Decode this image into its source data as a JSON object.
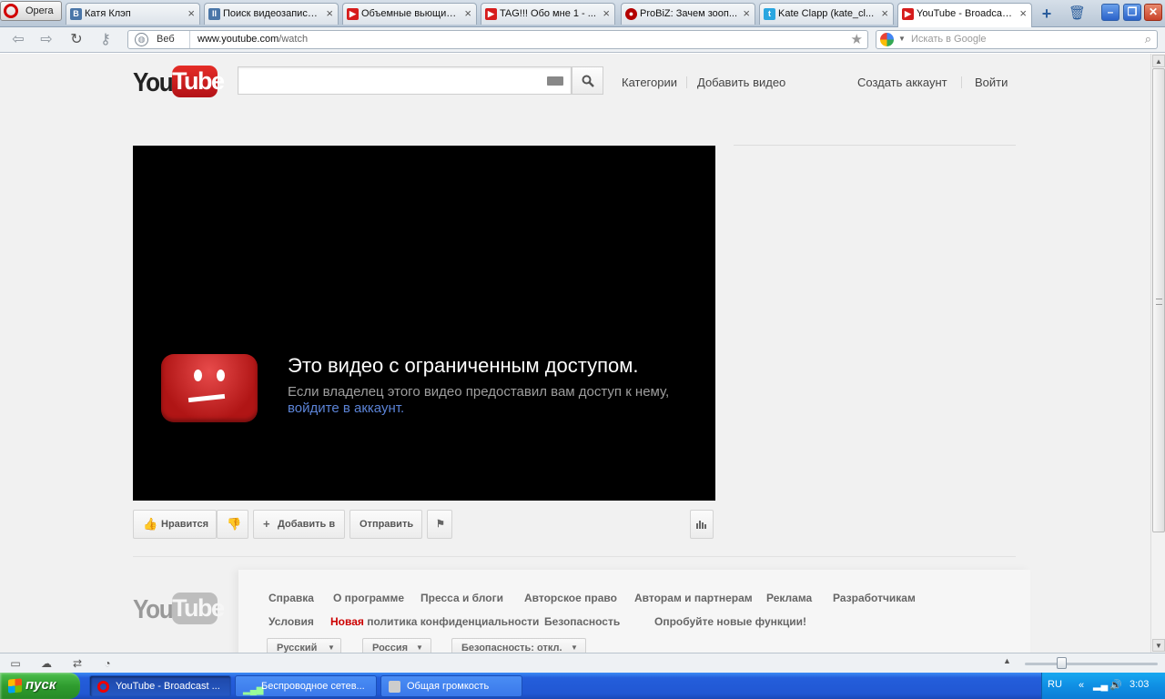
{
  "browser": {
    "menu_label": "Opera",
    "tabs": [
      {
        "title": "Катя Клэп",
        "icon": "vk-icon",
        "favicon_text": "B"
      },
      {
        "title": "Поиск видеозаписе...",
        "icon": "pause-icon",
        "favicon_text": "II"
      },
      {
        "title": "Объемные вьющие...",
        "icon": "youtube-icon",
        "favicon_text": "▶"
      },
      {
        "title": "TAG!!! Обо мне 1 - ...",
        "icon": "youtube-icon",
        "favicon_text": "▶"
      },
      {
        "title": "ProBiZ: Зачем зооп...",
        "icon": "probiz-icon",
        "favicon_text": "●"
      },
      {
        "title": "Kate Clapp (kate_cl...",
        "icon": "twitter-icon",
        "favicon_text": "t"
      },
      {
        "title": "YouTube - Broadcas...",
        "icon": "youtube-icon",
        "favicon_text": "▶"
      }
    ],
    "tab_close": "×",
    "add_tab": "+",
    "trash": "🗑",
    "window_buttons": {
      "minimize": "–",
      "restore": "❐",
      "close": "✕"
    },
    "address": {
      "scope_label": "Веб",
      "url_host": "www.youtube.com",
      "url_path": "/watch"
    },
    "search": {
      "placeholder": "Искать в Google"
    },
    "nav": {
      "back": "⇦",
      "forward": "⇨",
      "reload": "↻",
      "key": "⚷"
    }
  },
  "youtube": {
    "logo": {
      "you": "You",
      "tube": "Tube"
    },
    "header_links": {
      "categories": "Категории",
      "upload": "Добавить видео",
      "create_account": "Создать аккаунт",
      "sign_in": "Войти"
    },
    "player": {
      "title": "Это видео с ограниченным доступом.",
      "message": "Если владелец этого видео предоставил вам доступ к нему,",
      "link": "войдите в аккаунт."
    },
    "actions": {
      "like": "Нравится",
      "add_to": "Добавить в",
      "share": "Отправить"
    },
    "footer": {
      "row1": [
        "Справка",
        "О программе",
        "Пресса и блоги",
        "Авторское право",
        "Авторам и партнерам",
        "Реклама",
        "Разработчикам"
      ],
      "terms": "Условия",
      "privacy_new": "Новая",
      "privacy_rest": "политика конфиденциальности",
      "safety": "Безопасность",
      "try_new": "Опробуйте новые функции!",
      "selects": {
        "language": "Русский",
        "country": "Россия",
        "safety_mode": "Безопасность: откл."
      }
    }
  },
  "taskbar": {
    "start_label": "пуск",
    "items": [
      {
        "label": "YouTube - Broadcast ...",
        "active": true
      },
      {
        "label": "Беспроводное сетев...",
        "active": false
      },
      {
        "label": "Общая громкость",
        "active": false
      }
    ],
    "tray": {
      "lang": "RU",
      "clock": "3:03"
    }
  }
}
